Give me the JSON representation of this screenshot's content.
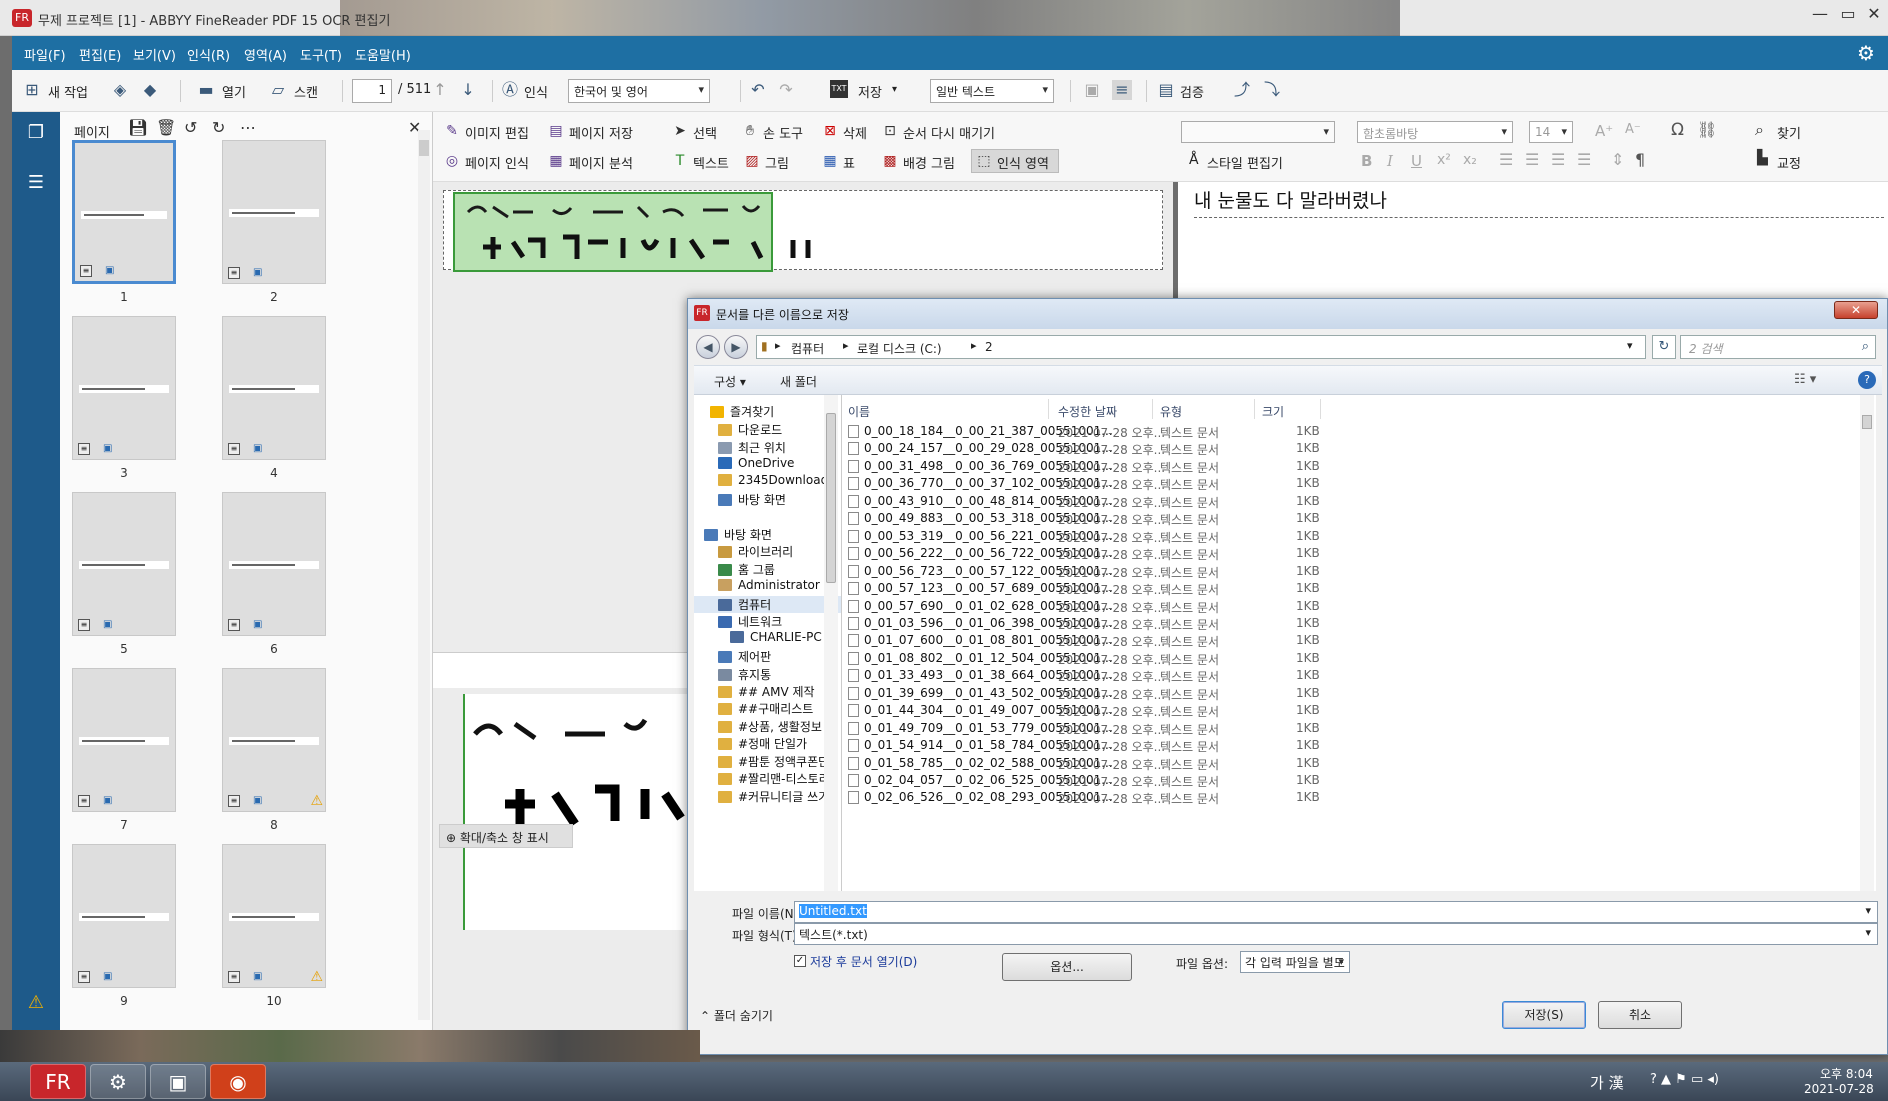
{
  "app": {
    "title": "무제 프로젝트 [1] - ABBYY FineReader PDF 15 OCR 편집기",
    "logo": "FR"
  },
  "menu": [
    "파일(F)",
    "편집(E)",
    "보기(V)",
    "인식(R)",
    "영역(A)",
    "도구(T)",
    "도움말(H)"
  ],
  "toolbar": {
    "new_task": "새 작업",
    "open": "열기",
    "scan": "스캔",
    "page_current": "1",
    "page_total": "/ 511",
    "recognize": "인식",
    "language": "한국어 및 영어",
    "save": "저장",
    "save_format": "TXT",
    "text_mode": "일반 텍스트",
    "verify": "검증"
  },
  "pages_panel": {
    "title": "페이지",
    "pages": [
      "1",
      "2",
      "3",
      "4",
      "5",
      "6",
      "7",
      "8",
      "9",
      "10"
    ],
    "warnings": [
      8,
      10
    ]
  },
  "ribbon": {
    "image_edit": "이미지 편집",
    "page_save": "페이지 저장",
    "page_recognize": "페이지 인식",
    "page_analyze": "페이지 분석",
    "select": "선택",
    "hand_tool": "손 도구",
    "delete": "삭제",
    "reorder": "순서 다시 매기기",
    "text": "텍스트",
    "picture": "그림",
    "table": "표",
    "bg_picture": "배경 그림",
    "recognize_area": "인식 영역",
    "font": "함초롬바탕",
    "size": "14",
    "style_edit": "스타일 편집기",
    "find": "찾기",
    "proofread": "교정"
  },
  "zoom_label": "확대/축소 창 표시",
  "text_pane": {
    "content": "내 눈물도 다 말라버렸나"
  },
  "dialog": {
    "title": "문서를 다른 이름으로 저장",
    "breadcrumb": [
      "컴퓨터",
      "로컬 디스크 (C:)",
      "2"
    ],
    "search_placeholder": "2 검색",
    "organize": "구성",
    "new_folder": "새 폴더",
    "columns": {
      "name": "이름",
      "modified": "수정한 날짜",
      "type": "유형",
      "size": "크기"
    },
    "nav": {
      "favorites": "즐겨찾기",
      "downloads": "다운로드",
      "recent": "최근 위치",
      "onedrive": "OneDrive",
      "downloads2345": "2345Downloads",
      "desktop_fav": "바탕 화면",
      "desktop": "바탕 화면",
      "libraries": "라이브러리",
      "homegroup": "홈 그룹",
      "admin": "Administrator",
      "computer": "컴퓨터",
      "network": "네트워크",
      "charlie": "CHARLIE-PC",
      "control": "제어판",
      "trash": "휴지통",
      "amv": "## AMV 제작",
      "buy": "##구매리스트",
      "product": "#상품, 생활정보",
      "sale": "#정매 단일가",
      "coupang": "#팜툰 정액쿠폰단",
      "jjalbang": "#짤리맨-티스토리",
      "community": "#커뮤니티글 쓰기"
    },
    "files": [
      "0_00_18_184__0_00_21_387_00551001...",
      "0_00_24_157__0_00_29_028_00551001...",
      "0_00_31_498__0_00_36_769_00551001...",
      "0_00_36_770__0_00_37_102_00551001...",
      "0_00_43_910__0_00_48_814_00551001...",
      "0_00_49_883__0_00_53_318_00551001...",
      "0_00_53_319__0_00_56_221_00551001...",
      "0_00_56_222__0_00_56_722_00551001...",
      "0_00_56_723__0_00_57_122_00551001...",
      "0_00_57_123__0_00_57_689_00551001...",
      "0_00_57_690__0_01_02_628_00551001...",
      "0_01_03_596__0_01_06_398_00551001...",
      "0_01_07_600__0_01_08_801_00551001...",
      "0_01_08_802__0_01_12_504_00551001...",
      "0_01_33_493__0_01_38_664_00551001...",
      "0_01_39_699__0_01_43_502_00551001...",
      "0_01_44_304__0_01_49_007_00551001...",
      "0_01_49_709__0_01_53_779_00551001...",
      "0_01_54_914__0_01_58_784_00551001...",
      "0_01_58_785__0_02_02_588_00551001...",
      "0_02_04_057__0_02_06_525_00551001...",
      "0_02_06_526__0_02_08_293_00551001..."
    ],
    "file_date": "2021-07-28 오후...",
    "file_type": "텍스트 문서",
    "file_size": "1KB",
    "filename_label": "파일 이름(N):",
    "filename_value": "Untitled.txt",
    "filetype_label": "파일 형식(T):",
    "filetype_value": "텍스트(*.txt)",
    "open_after_save": "저장 후 문서 열기(D)",
    "options_button": "옵션...",
    "file_options_label": "파일 옵션:",
    "file_options_value": "각 입력 파일을 별도",
    "hide_folders": "폴더 숨기기",
    "save_button": "저장(S)",
    "cancel_button": "취소"
  },
  "taskbar": {
    "ime": "가 漢",
    "time": "오후 8:04",
    "date": "2021-07-28"
  },
  "colors": {
    "menubar": "#1e6fa3",
    "leftstrip": "#1e5a8a",
    "ocr_green": "#7ec87e",
    "selection": "#3399ff"
  }
}
